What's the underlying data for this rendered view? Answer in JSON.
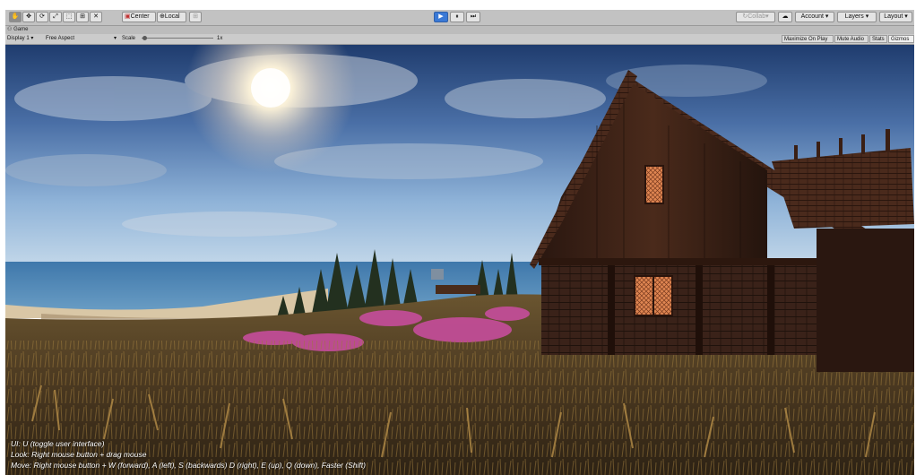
{
  "toolbar": {
    "tools": [
      {
        "name": "hand-tool",
        "glyph": "✋"
      },
      {
        "name": "move-tool",
        "glyph": "✥"
      },
      {
        "name": "rotate-tool",
        "glyph": "⟳"
      },
      {
        "name": "scale-tool",
        "glyph": "⤢"
      },
      {
        "name": "rect-tool",
        "glyph": "⬚"
      },
      {
        "name": "transform-tool",
        "glyph": "⊞"
      },
      {
        "name": "custom-tool",
        "glyph": "✕"
      }
    ],
    "pivot_label": "Center",
    "space_label": "Local",
    "play_glyph": "▶",
    "pause_glyph": "⏸",
    "step_glyph": "⏭",
    "collab_label": "Collab",
    "account_label": "Account",
    "layers_label": "Layers",
    "layout_label": "Layout",
    "dropdown_glyph": "▾",
    "cloud_glyph": "☁"
  },
  "game_tab": {
    "label": "Game",
    "icon": "game-controller-icon"
  },
  "game_bar": {
    "display": "Display 1",
    "aspect": "Free Aspect",
    "scale_label": "Scale",
    "scale_value": "1x",
    "maximize_on_play": "Maximize On Play",
    "mute_audio": "Mute Audio",
    "stats": "Stats",
    "gizmos": "Gizmos"
  },
  "overlay": {
    "line1": "UI: U (toggle user interface)",
    "line2": "Look: Right mouse button + drag mouse",
    "line3": "Move: Right mouse button + W (forward), A (left), S (backwards) D (right), E (up), Q (down), Faster (Shift)"
  },
  "colors": {
    "play_accent": "#3a79d6",
    "toolbar_bg": "#c2c2c2",
    "window_glow": "#e58a55"
  }
}
